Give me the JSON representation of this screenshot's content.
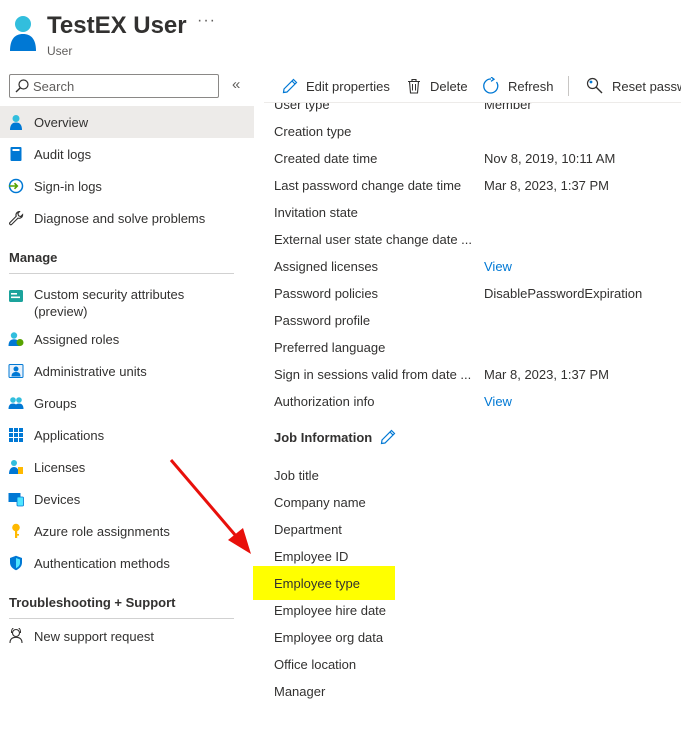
{
  "header": {
    "title": "TestEX User",
    "more": "···",
    "subtitle": "User"
  },
  "search": {
    "placeholder": "Search",
    "collapse": "«"
  },
  "sidebar": {
    "top_items": [
      {
        "label": "Overview",
        "icon": "user-icon",
        "selected": true
      },
      {
        "label": "Audit logs",
        "icon": "book-icon"
      },
      {
        "label": "Sign-in logs",
        "icon": "sign-in-icon"
      },
      {
        "label": "Diagnose and solve problems",
        "icon": "wrench-icon"
      }
    ],
    "manage_header": "Manage",
    "manage_items": [
      {
        "label": "Custom security attributes (preview)",
        "icon": "security-attributes-icon"
      },
      {
        "label": "Assigned roles",
        "icon": "roles-icon"
      },
      {
        "label": "Administrative units",
        "icon": "admin-units-icon"
      },
      {
        "label": "Groups",
        "icon": "groups-icon"
      },
      {
        "label": "Applications",
        "icon": "apps-grid-icon"
      },
      {
        "label": "Licenses",
        "icon": "license-icon"
      },
      {
        "label": "Devices",
        "icon": "devices-icon"
      },
      {
        "label": "Azure role assignments",
        "icon": "key-icon"
      },
      {
        "label": "Authentication methods",
        "icon": "shield-icon"
      }
    ],
    "troubleshooting_header": "Troubleshooting + Support",
    "troubleshooting_items": [
      {
        "label": "New support request",
        "icon": "support-icon"
      }
    ]
  },
  "toolbar": {
    "edit": "Edit properties",
    "delete": "Delete",
    "refresh": "Refresh",
    "reset": "Reset passw"
  },
  "properties": [
    {
      "label": "User type",
      "value": "Member",
      "link": false
    },
    {
      "label": "Creation type",
      "value": "",
      "link": false
    },
    {
      "label": "Created date time",
      "value": "Nov 8, 2019, 10:11 AM",
      "link": false
    },
    {
      "label": "Last password change date time",
      "value": "Mar 8, 2023, 1:37 PM",
      "link": false
    },
    {
      "label": "Invitation state",
      "value": "",
      "link": false
    },
    {
      "label": "External user state change date ...",
      "value": "",
      "link": false
    },
    {
      "label": "Assigned licenses",
      "value": "View",
      "link": true
    },
    {
      "label": "Password policies",
      "value": "DisablePasswordExpiration",
      "link": false
    },
    {
      "label": "Password profile",
      "value": "",
      "link": false
    },
    {
      "label": "Preferred language",
      "value": "",
      "link": false
    },
    {
      "label": "Sign in sessions valid from date ...",
      "value": "Mar 8, 2023, 1:37 PM",
      "link": false
    },
    {
      "label": "Authorization info",
      "value": "View",
      "link": true
    }
  ],
  "job_section": {
    "title": "Job Information",
    "fields": [
      "Job title",
      "Company name",
      "Department",
      "Employee ID",
      "Employee type",
      "Employee hire date",
      "Employee org data",
      "Office location",
      "Manager"
    ]
  },
  "colors": {
    "accent": "#0078d4",
    "highlight": "#ffff00",
    "arrow": "#e8100b",
    "selected_bg": "#edebe9"
  }
}
